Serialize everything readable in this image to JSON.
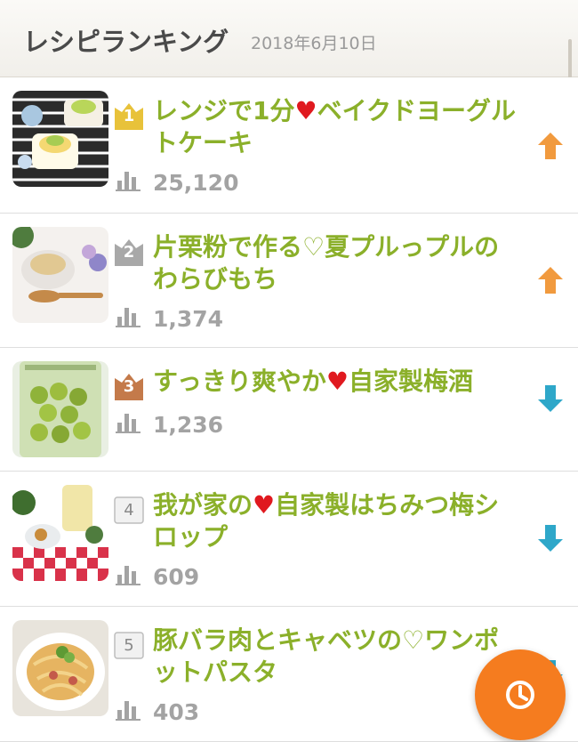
{
  "header": {
    "title": "レシピランキング",
    "date": "2018年6月10日"
  },
  "recipes": [
    {
      "rank": "1",
      "title_line1": "レンジで1分",
      "heart": "♥",
      "title_line1b": "ベイクドヨーグル",
      "title_line2": "トケーキ",
      "views": "25,120",
      "trend": "up"
    },
    {
      "rank": "2",
      "title_line1": "片栗粉で作る♡夏プルっプルの",
      "title_line2": "わらびもち",
      "views": "1,374",
      "trend": "up"
    },
    {
      "rank": "3",
      "title_line1": "すっきり爽やか",
      "heart": "♥",
      "title_line1b": "自家製梅酒",
      "title_line2": "",
      "views": "1,236",
      "trend": "down"
    },
    {
      "rank": "4",
      "title_line1": "我が家の",
      "heart": "♥",
      "title_line1b": "自家製はちみつ梅シ",
      "title_line2": "ロップ",
      "views": "609",
      "trend": "down"
    },
    {
      "rank": "5",
      "title_line1": "豚バラ肉とキャベツの♡ワンポ",
      "title_line2": "ットパスタ",
      "views": "403",
      "trend": "down"
    }
  ],
  "colors": {
    "title_green": "#8bb02a",
    "heart_red": "#e0191f",
    "up_orange": "#f19a3e",
    "down_blue": "#2ea7c9",
    "gold": "#e8c23a",
    "silver": "#a8a8a8",
    "bronze": "#c47a4a",
    "fab_orange": "#f57c1f"
  },
  "icons": {
    "stats": "bar-chart-icon",
    "up": "arrow-up-icon",
    "down": "arrow-down-icon",
    "fab": "clock-icon"
  }
}
